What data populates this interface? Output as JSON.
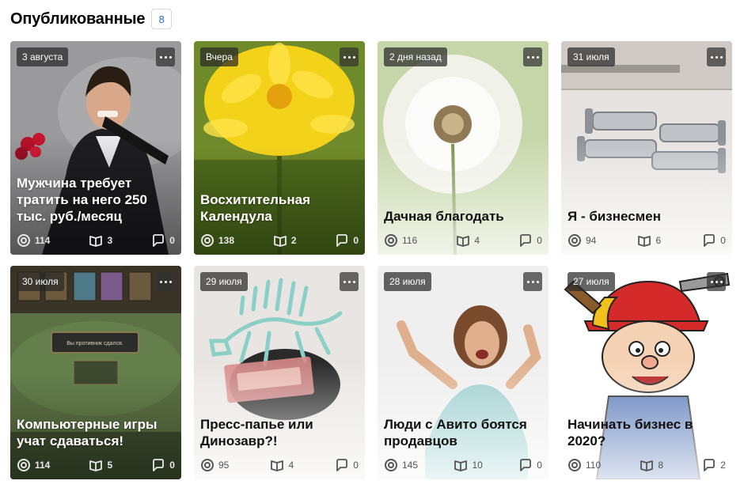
{
  "header": {
    "title": "Опубликованные",
    "count": "8"
  },
  "cards": [
    {
      "date": "3 августа",
      "title": "Мужчина требует тратить на него 250 тыс. руб./месяц",
      "views": "114",
      "reads": "3",
      "comments": "0"
    },
    {
      "date": "Вчера",
      "title": "Восхитительная Календула",
      "views": "138",
      "reads": "2",
      "comments": "0"
    },
    {
      "date": "2 дня назад",
      "title": "Дачная благодать",
      "views": "116",
      "reads": "4",
      "comments": "0"
    },
    {
      "date": "31 июля",
      "title": "Я - бизнесмен",
      "views": "94",
      "reads": "6",
      "comments": "0"
    },
    {
      "date": "30 июля",
      "title": "Компьютерные игры учат сдаваться!",
      "views": "114",
      "reads": "5",
      "comments": "0",
      "game_text": "Вы противник сдался."
    },
    {
      "date": "29 июля",
      "title": "Пресс-папье или Динозавр?!",
      "views": "95",
      "reads": "4",
      "comments": "0"
    },
    {
      "date": "28 июля",
      "title": "Люди с Авито боятся продавцов",
      "views": "145",
      "reads": "10",
      "comments": "0"
    },
    {
      "date": "27 июля",
      "title": "Начинать бизнес в 2020?",
      "views": "110",
      "reads": "8",
      "comments": "2"
    }
  ]
}
